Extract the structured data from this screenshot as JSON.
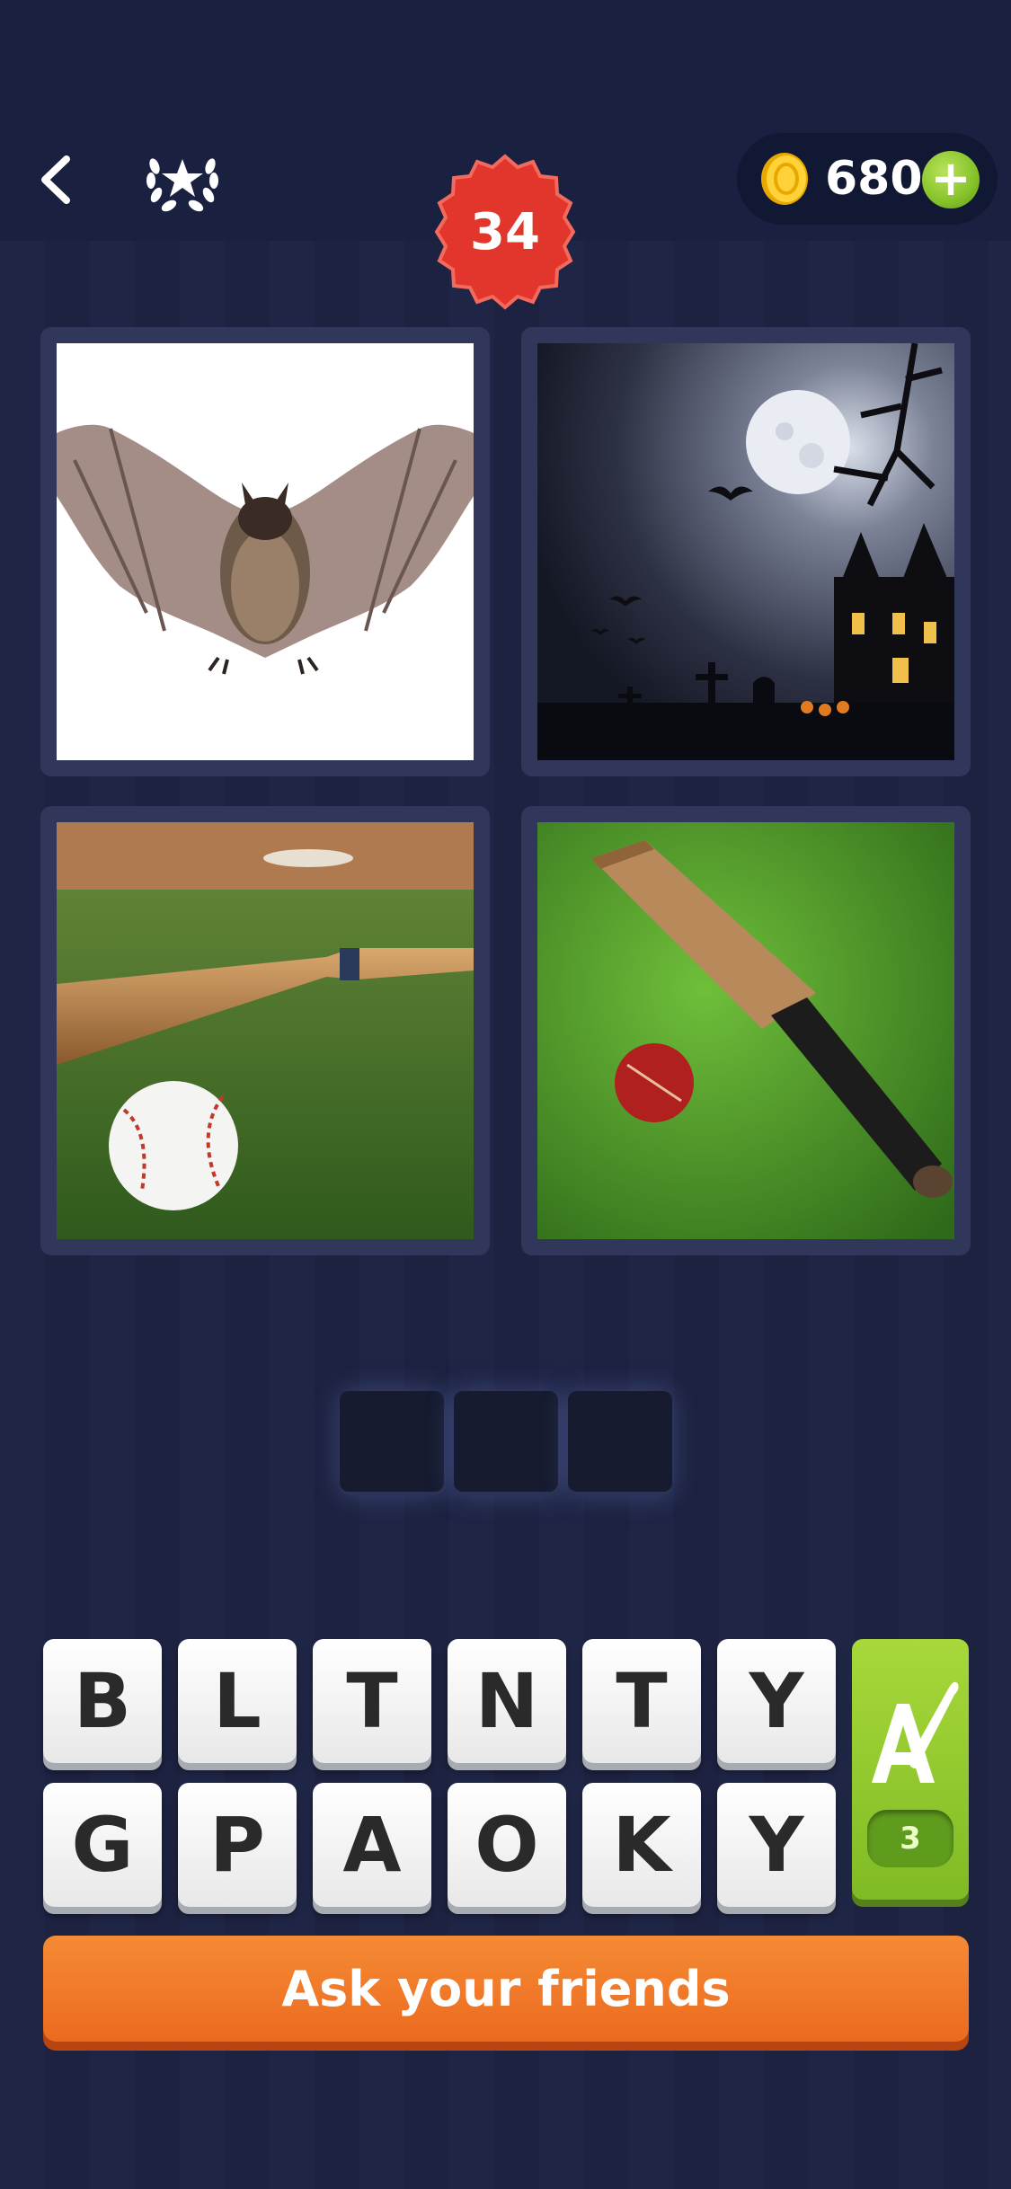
{
  "header": {
    "level": "34",
    "coins": "680",
    "back_icon": "chevron-left-icon",
    "trophy_icon": "laurel-star-icon",
    "add_coins_label": "+"
  },
  "puzzle": {
    "images": [
      {
        "subject": "bat-animal"
      },
      {
        "subject": "halloween-night-bats"
      },
      {
        "subject": "baseball-bat"
      },
      {
        "subject": "cricket-bat"
      }
    ],
    "answer_slots": [
      "",
      "",
      ""
    ]
  },
  "keyboard": {
    "row1": [
      "B",
      "L",
      "T",
      "N",
      "T",
      "Y"
    ],
    "row2": [
      "G",
      "P",
      "A",
      "O",
      "K",
      "Y"
    ]
  },
  "hint": {
    "icon": "paintbrush-a-icon",
    "count": "3"
  },
  "ask_friends": {
    "label": "Ask your friends"
  },
  "colors": {
    "background": "#1e2443",
    "badge_red": "#e03a2f",
    "hint_green": "#8cc63f",
    "button_orange": "#f07a29"
  }
}
